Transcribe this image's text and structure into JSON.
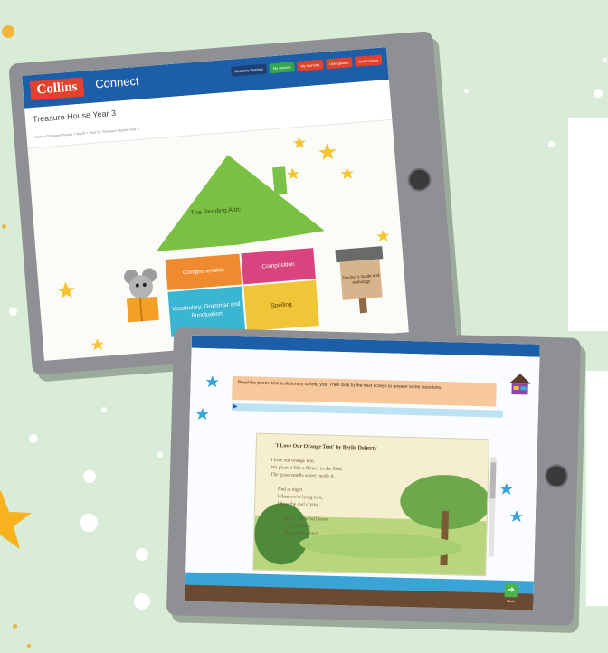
{
  "tablet1": {
    "brand": "Collins",
    "app_name": "Connect",
    "nav": [
      {
        "label": "Welcome Teacher",
        "color": "#1d3f74"
      },
      {
        "label": "My classes",
        "color": "#33a64b"
      },
      {
        "label": "My learning",
        "color": "#e2412c"
      },
      {
        "label": "User guides",
        "color": "#e2412c"
      },
      {
        "label": "Notifications",
        "color": "#e2412c"
      }
    ],
    "course_title": "Treasure House Year 3",
    "breadcrumb": "Home • Treasure House • Teach • Year 3 • Treasure House Year 3",
    "roof_label": "The Reading Attic",
    "blocks": {
      "comprehension": "Comprehension",
      "composition": "Composition",
      "vocabulary": "Vocabulary, Grammar and Punctuation",
      "spelling": "Spelling"
    },
    "sign_label": "Teacher's Guide and Anthology"
  },
  "tablet2": {
    "instruction": "Read the poem. Use a dictionary to help you. Then click to the next screen to answer some questions.",
    "poem_title": "'I Love Our Orange Tent' by Berlie Doherty",
    "poem_lines": "I love our orange tent.\nWe plant it like a flower in the field.\nThe grass smells sweet inside it.\n\n      And at night\n      When we're lying in it,\n      I hear the owl crying.\n\n            When the wind blows\n            our tent flaps\n            like a flying bird.",
    "next_label": "Next"
  },
  "colors": {
    "accent_blue": "#1d5ea9",
    "background": "#d9ecd7",
    "roof_green": "#7ac143"
  }
}
